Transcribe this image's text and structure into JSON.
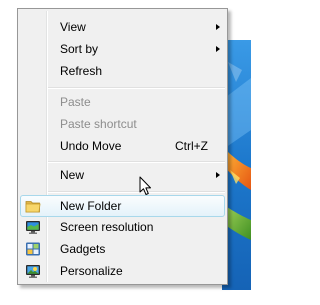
{
  "context_menu": {
    "view_label": "View",
    "sort_by_label": "Sort by",
    "refresh_label": "Refresh",
    "paste_label": "Paste",
    "paste_shortcut_label": "Paste shortcut",
    "undo_move_label": "Undo Move",
    "undo_move_shortcut": "Ctrl+Z",
    "new_label": "New",
    "new_folder_label": "New Folder",
    "screen_resolution_label": "Screen resolution",
    "gadgets_label": "Gadgets",
    "personalize_label": "Personalize"
  },
  "icons": {
    "new_folder": "folder-icon",
    "screen_resolution": "monitor-icon",
    "gadgets": "gadgets-icon",
    "personalize": "personalize-icon",
    "cursor": "mouse-pointer-icon"
  },
  "colors": {
    "menu_background": "#f0f0f0",
    "menu_border": "#979797",
    "hover_border": "#a8d8eb",
    "disabled_text": "#8d8d8d",
    "wallpaper_blue": "#1e7fd0"
  }
}
